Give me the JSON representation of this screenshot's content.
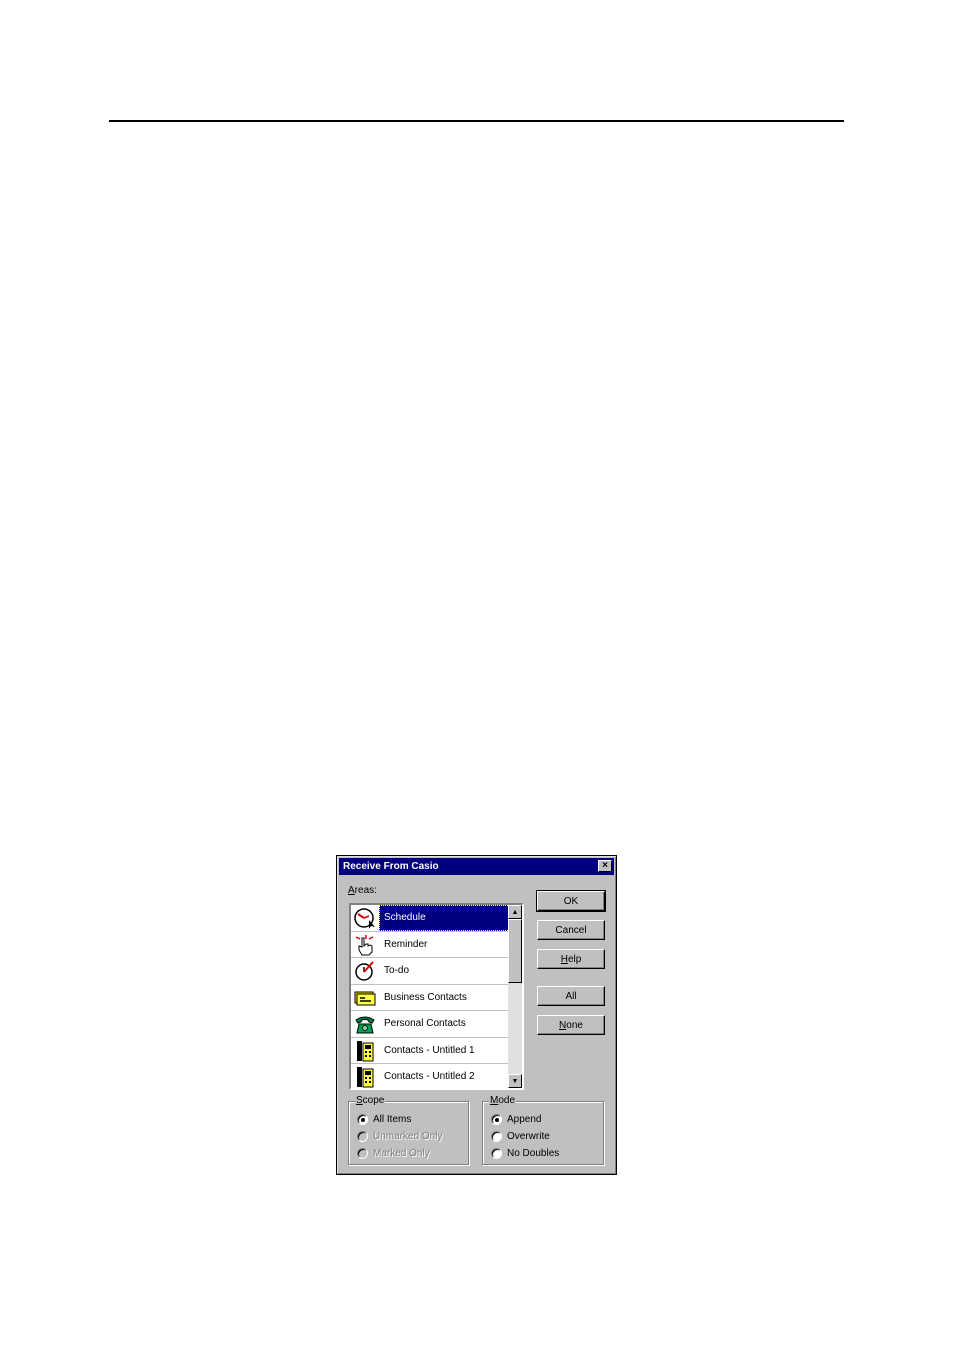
{
  "dialog": {
    "title": "Receive From Casio",
    "close_glyph": "×"
  },
  "areas": {
    "label_mnemonic": "A",
    "label_rest": "reas:",
    "items": [
      {
        "label": "Schedule",
        "icon": "clock-icon",
        "selected": true
      },
      {
        "label": "Reminder",
        "icon": "hand-reminder-icon",
        "selected": false
      },
      {
        "label": "To-do",
        "icon": "todo-clock-icon",
        "selected": false
      },
      {
        "label": "Business Contacts",
        "icon": "business-card-icon",
        "selected": false
      },
      {
        "label": "Personal Contacts",
        "icon": "telephone-icon",
        "selected": false
      },
      {
        "label": "Contacts - Untitled 1",
        "icon": "phone-handset-icon",
        "selected": false
      },
      {
        "label": "Contacts - Untitled 2",
        "icon": "phone-handset-icon",
        "selected": false
      }
    ]
  },
  "buttons": {
    "ok": "OK",
    "cancel": "Cancel",
    "help_mnemonic": "H",
    "help_rest": "elp",
    "all": "All",
    "none_mnemonic": "N",
    "none_rest": "one"
  },
  "scope": {
    "title_mnemonic": "S",
    "title_rest": "cope",
    "options": [
      {
        "label": "All Items",
        "checked": true,
        "disabled": false
      },
      {
        "label": "Unmarked Only",
        "checked": false,
        "disabled": true
      },
      {
        "label": "Marked Only",
        "checked": false,
        "disabled": true
      }
    ]
  },
  "mode": {
    "title_mnemonic": "M",
    "title_rest": "ode",
    "options": [
      {
        "label": "Append",
        "checked": true,
        "disabled": false
      },
      {
        "label": "Overwrite",
        "checked": false,
        "disabled": false
      },
      {
        "label": "No Doubles",
        "checked": false,
        "disabled": false
      }
    ]
  },
  "colors": {
    "titlebar": "#000080",
    "face": "#c0c0c0",
    "selection": "#000080"
  }
}
